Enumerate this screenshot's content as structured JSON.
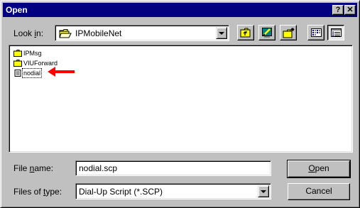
{
  "window": {
    "title": "Open",
    "help_label": "?",
    "close_label": "✕"
  },
  "look_in": {
    "label_prefix": "Look ",
    "label_accel": "i",
    "label_suffix": "n:",
    "value": "IPMobileNet"
  },
  "toolbar": {
    "buttons": [
      "up-one-level",
      "desktop",
      "create-new-folder",
      "list-view",
      "details-view"
    ]
  },
  "files": [
    {
      "name": "IPMsg",
      "type": "folder"
    },
    {
      "name": "VIUForward",
      "type": "folder"
    },
    {
      "name": "nodial",
      "type": "script",
      "selected": true
    }
  ],
  "annotation": {
    "arrow_color": "#ff0000"
  },
  "file_name": {
    "label_prefix": "File ",
    "label_accel": "n",
    "label_suffix": "ame:",
    "value": "nodial.scp"
  },
  "files_of_type": {
    "label_prefix": "Files of ",
    "label_accel": "t",
    "label_suffix": "ype:",
    "value": "Dial-Up Script (*.SCP)"
  },
  "buttons": {
    "open_accel": "O",
    "open_rest": "pen",
    "cancel": "Cancel"
  },
  "colors": {
    "title_bar": "#000080",
    "face": "#c0c0c0"
  }
}
